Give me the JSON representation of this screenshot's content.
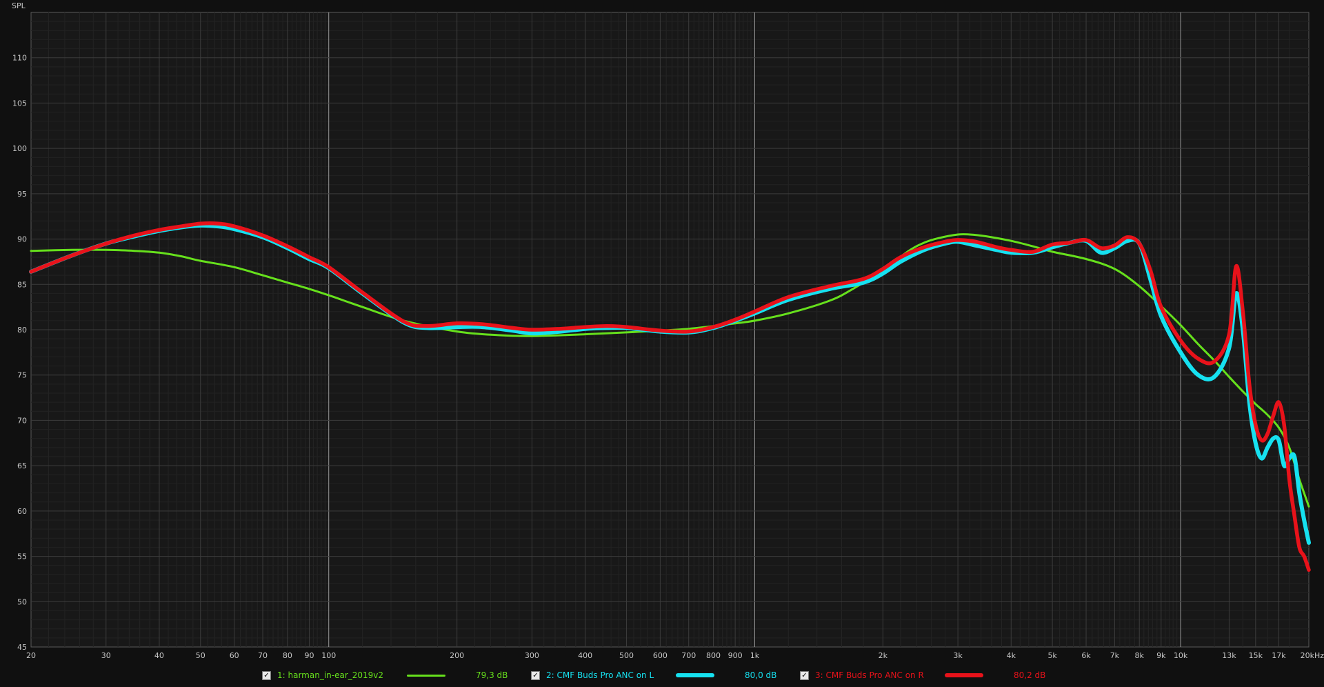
{
  "chart_data": {
    "type": "line",
    "ylabel": "SPL",
    "x_scale": "log",
    "xlim": [
      20,
      20000
    ],
    "ylim": [
      45,
      115
    ],
    "grid": true,
    "x_ticks": [
      {
        "v": 20,
        "label": "20"
      },
      {
        "v": 30,
        "label": "30"
      },
      {
        "v": 40,
        "label": "40"
      },
      {
        "v": 50,
        "label": "50"
      },
      {
        "v": 60,
        "label": "60"
      },
      {
        "v": 70,
        "label": "70"
      },
      {
        "v": 80,
        "label": "80"
      },
      {
        "v": 90,
        "label": "90"
      },
      {
        "v": 100,
        "label": "100"
      },
      {
        "v": 200,
        "label": "200"
      },
      {
        "v": 300,
        "label": "300"
      },
      {
        "v": 400,
        "label": "400"
      },
      {
        "v": 500,
        "label": "500"
      },
      {
        "v": 600,
        "label": "600"
      },
      {
        "v": 700,
        "label": "700"
      },
      {
        "v": 800,
        "label": "800"
      },
      {
        "v": 900,
        "label": "900"
      },
      {
        "v": 1000,
        "label": "1k"
      },
      {
        "v": 2000,
        "label": "2k"
      },
      {
        "v": 3000,
        "label": "3k"
      },
      {
        "v": 4000,
        "label": "4k"
      },
      {
        "v": 5000,
        "label": "5k"
      },
      {
        "v": 6000,
        "label": "6k"
      },
      {
        "v": 7000,
        "label": "7k"
      },
      {
        "v": 8000,
        "label": "8k"
      },
      {
        "v": 9000,
        "label": "9k"
      },
      {
        "v": 10000,
        "label": "10k"
      },
      {
        "v": 13000,
        "label": "13k"
      },
      {
        "v": 15000,
        "label": "15k"
      },
      {
        "v": 17000,
        "label": "17k"
      },
      {
        "v": 20000,
        "label": "20kHz"
      }
    ],
    "y_ticks": [
      45,
      50,
      55,
      60,
      65,
      70,
      75,
      80,
      85,
      90,
      95,
      100,
      105,
      110
    ],
    "series": [
      {
        "name": "1: harman_in-ear_2019v2",
        "value": "79,3 dB",
        "color": "#66e01c",
        "x": [
          20,
          25,
          30,
          35,
          40,
          45,
          50,
          60,
          70,
          80,
          90,
          100,
          120,
          150,
          200,
          250,
          300,
          400,
          500,
          600,
          700,
          800,
          900,
          1000,
          1200,
          1500,
          1700,
          2000,
          2300,
          2500,
          2700,
          3000,
          3200,
          3500,
          4000,
          4500,
          5000,
          6000,
          7000,
          8000,
          9000,
          10000,
          11000,
          12000,
          13000,
          14000,
          15000,
          16000,
          17000,
          18000,
          19000,
          20000
        ],
        "values": [
          88.7,
          88.8,
          88.8,
          88.7,
          88.5,
          88.1,
          87.6,
          86.9,
          86.0,
          85.2,
          84.5,
          83.8,
          82.5,
          81.0,
          79.8,
          79.4,
          79.3,
          79.5,
          79.7,
          79.9,
          80.1,
          80.4,
          80.7,
          81.0,
          81.8,
          83.2,
          84.5,
          86.6,
          88.7,
          89.6,
          90.1,
          90.5,
          90.5,
          90.3,
          89.8,
          89.2,
          88.6,
          87.8,
          86.7,
          84.8,
          82.6,
          80.5,
          78.4,
          76.6,
          74.8,
          73.2,
          71.8,
          70.6,
          69.2,
          67.0,
          63.5,
          60.5
        ]
      },
      {
        "name": "2: CMF Buds Pro ANC on L",
        "value": "80,0 dB",
        "color": "#16e1f0",
        "x": [
          20,
          25,
          30,
          35,
          40,
          45,
          50,
          55,
          60,
          70,
          80,
          90,
          100,
          120,
          150,
          170,
          200,
          230,
          270,
          300,
          350,
          400,
          450,
          500,
          600,
          700,
          800,
          900,
          1000,
          1200,
          1500,
          1800,
          2000,
          2200,
          2500,
          2800,
          3000,
          3300,
          3700,
          4000,
          4500,
          5000,
          5500,
          6000,
          6500,
          7000,
          7500,
          8000,
          8500,
          9000,
          10000,
          11000,
          12000,
          13000,
          13500,
          14000,
          14500,
          15000,
          15500,
          16000,
          16500,
          17000,
          17500,
          18000,
          18500,
          19000,
          19500,
          20000
        ],
        "values": [
          86.4,
          88.2,
          89.5,
          90.3,
          90.9,
          91.3,
          91.5,
          91.4,
          91.1,
          90.2,
          89.0,
          87.8,
          86.8,
          84.0,
          80.8,
          80.2,
          80.3,
          80.3,
          79.9,
          79.6,
          79.8,
          80.1,
          80.2,
          80.2,
          79.8,
          79.7,
          80.2,
          81.0,
          81.8,
          83.3,
          84.5,
          85.2,
          86.2,
          87.5,
          88.8,
          89.5,
          89.7,
          89.3,
          88.8,
          88.5,
          88.5,
          89.1,
          89.6,
          89.8,
          88.5,
          89.0,
          89.8,
          89.5,
          85.5,
          81.5,
          77.5,
          75.0,
          74.8,
          78.0,
          84.0,
          80.0,
          72.0,
          67.5,
          65.8,
          67.0,
          68.0,
          67.8,
          65.0,
          65.8,
          66.0,
          62.0,
          59.0,
          56.5
        ]
      },
      {
        "name": "3: CMF Buds Pro ANC on R",
        "value": "80,2 dB",
        "color": "#e8121a",
        "x": [
          20,
          25,
          30,
          35,
          40,
          45,
          50,
          55,
          60,
          70,
          80,
          90,
          100,
          120,
          150,
          170,
          200,
          230,
          270,
          300,
          350,
          400,
          450,
          500,
          600,
          700,
          800,
          900,
          1000,
          1200,
          1500,
          1800,
          2000,
          2200,
          2500,
          2800,
          3000,
          3300,
          3700,
          4000,
          4500,
          5000,
          5500,
          6000,
          6500,
          7000,
          7500,
          8000,
          8500,
          9000,
          10000,
          11000,
          12000,
          13000,
          13500,
          14000,
          14500,
          15000,
          15500,
          16000,
          16500,
          17000,
          17500,
          18000,
          18500,
          19000,
          19500,
          20000
        ],
        "values": [
          86.4,
          88.2,
          89.5,
          90.4,
          91.0,
          91.4,
          91.7,
          91.7,
          91.4,
          90.4,
          89.2,
          88.0,
          86.9,
          84.1,
          80.9,
          80.4,
          80.7,
          80.6,
          80.2,
          80.0,
          80.1,
          80.3,
          80.4,
          80.3,
          79.9,
          79.8,
          80.3,
          81.1,
          82.0,
          83.6,
          84.8,
          85.6,
          86.7,
          88.0,
          89.1,
          89.7,
          89.9,
          89.7,
          89.1,
          88.8,
          88.6,
          89.4,
          89.6,
          89.9,
          89.0,
          89.3,
          90.2,
          89.5,
          86.5,
          82.5,
          78.8,
          76.8,
          76.5,
          79.5,
          87.0,
          82.0,
          74.0,
          69.5,
          67.8,
          68.5,
          70.5,
          72.0,
          69.5,
          63.5,
          59.5,
          56.0,
          55.0,
          53.5
        ]
      }
    ]
  }
}
